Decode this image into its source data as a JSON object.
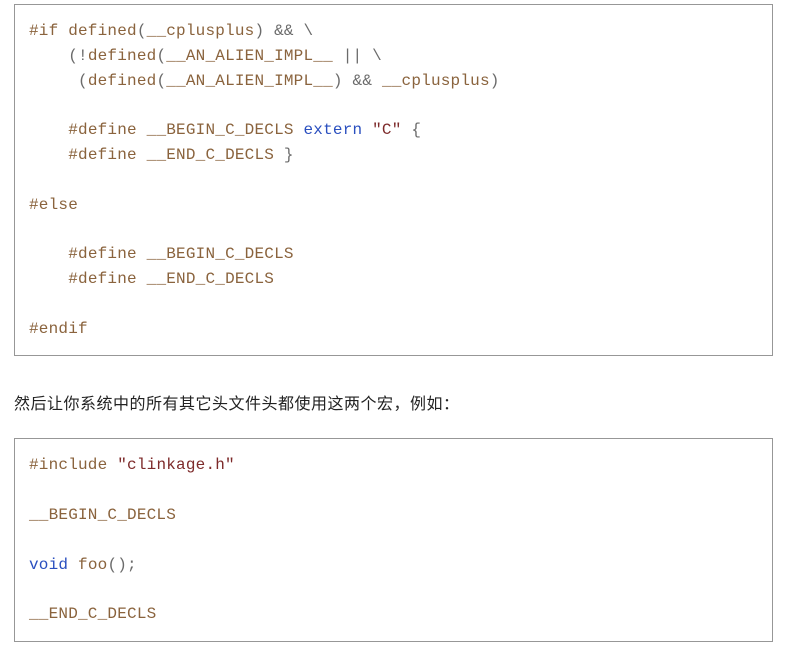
{
  "code1": {
    "l1": {
      "dir": "#if",
      "t1": " defined",
      "p1": "(",
      "m1": "__cplusplus",
      "p2": ")",
      "op1": " && ",
      "bs": "\\"
    },
    "l2": {
      "pad": "    ",
      "p1": "(!",
      "t1": "defined",
      "p2": "(",
      "m1": "__AN_ALIEN_IMPL__",
      "op1": " || ",
      "bs": "\\"
    },
    "l3": {
      "pad": "     ",
      "p1": "(",
      "t1": "defined",
      "p2": "(",
      "m1": "__AN_ALIEN_IMPL__",
      "p3": ")",
      "op1": " && ",
      "m2": "__cplusplus",
      "p4": ")"
    },
    "l4": {
      "pad": "    ",
      "dir": "#define",
      "sp": " ",
      "m1": "__BEGIN_C_DECLS",
      "sp2": " ",
      "kw": "extern",
      "sp3": " ",
      "str": "\"C\"",
      "sp4": " ",
      "br": "{"
    },
    "l5": {
      "pad": "    ",
      "dir": "#define",
      "sp": " ",
      "m1": "__END_C_DECLS",
      "sp2": " ",
      "br": "}"
    },
    "l6": {
      "dir": "#else"
    },
    "l7": {
      "pad": "    ",
      "dir": "#define",
      "sp": " ",
      "m1": "__BEGIN_C_DECLS"
    },
    "l8": {
      "pad": "    ",
      "dir": "#define",
      "sp": " ",
      "m1": "__END_C_DECLS"
    },
    "l9": {
      "dir": "#endif"
    }
  },
  "prose": "然后让你系统中的所有其它头文件头都使用这两个宏，例如：",
  "code2": {
    "l1": {
      "dir": "#include",
      "sp": " ",
      "str": "\"clinkage.h\""
    },
    "l2": {
      "m1": "__BEGIN_C_DECLS"
    },
    "l3": {
      "kw": "void",
      "sp": " ",
      "fn": "foo",
      "p": "();"
    },
    "l4": {
      "m1": "__END_C_DECLS"
    }
  }
}
